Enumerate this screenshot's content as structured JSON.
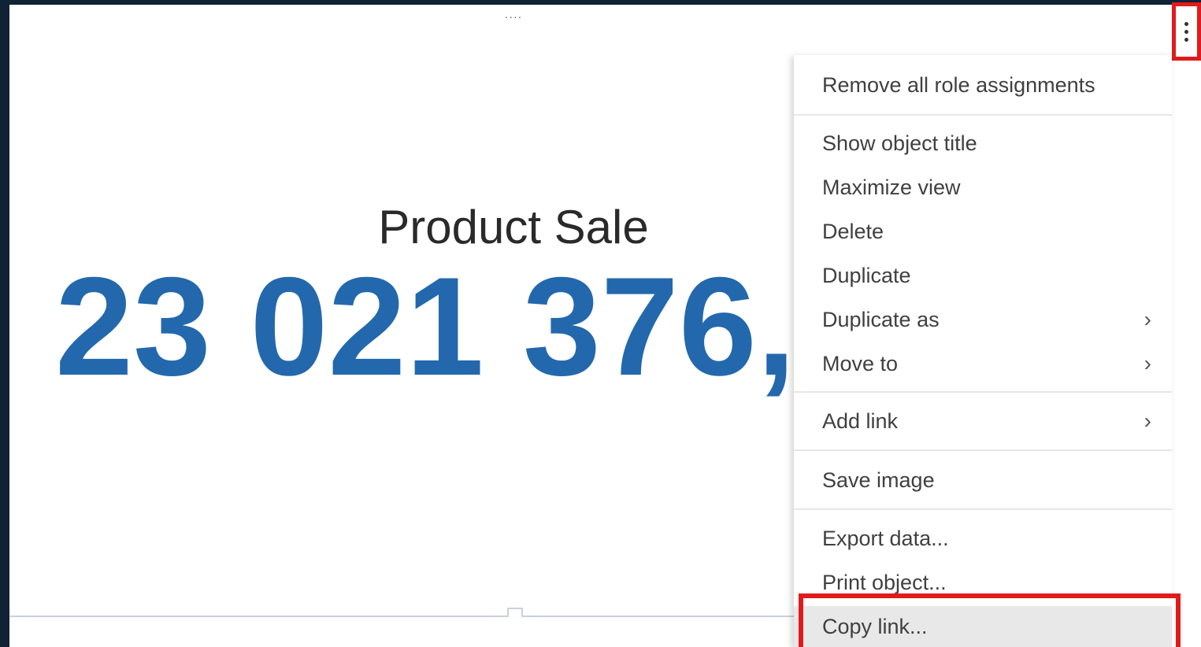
{
  "kpi": {
    "drag_handle": "····",
    "title": "Product Sale",
    "value": "23 021 376,"
  },
  "menu": {
    "items": [
      {
        "label": "Remove all role assignments",
        "submenu": false
      },
      {
        "label": "Show object title",
        "submenu": false
      },
      {
        "label": "Maximize view",
        "submenu": false
      },
      {
        "label": "Delete",
        "submenu": false
      },
      {
        "label": "Duplicate",
        "submenu": false
      },
      {
        "label": "Duplicate as",
        "submenu": true
      },
      {
        "label": "Move to",
        "submenu": true
      },
      {
        "label": "Add link",
        "submenu": true
      },
      {
        "label": "Save image",
        "submenu": false
      },
      {
        "label": "Export data...",
        "submenu": false
      },
      {
        "label": "Print object...",
        "submenu": false
      },
      {
        "label": "Copy link...",
        "submenu": false
      }
    ],
    "chevron": "›"
  },
  "colors": {
    "kpi_value": "#2368ad",
    "highlight": "#e11b1b",
    "frame": "#0f2236"
  },
  "icons": {
    "more": "kebab-vertical-icon",
    "chevron": "chevron-right-icon"
  }
}
